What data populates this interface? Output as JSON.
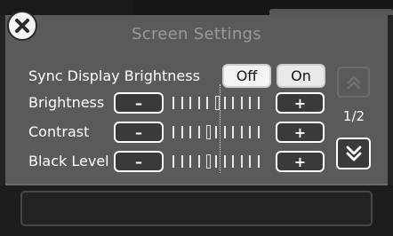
{
  "screen": {
    "title": "Screen Settings",
    "page_indicator": "1/2"
  },
  "close_icon": "close-icon",
  "settings": {
    "sync": {
      "label": "Sync Display Brightness",
      "off_label": "Off",
      "on_label": "On",
      "selected": "Off"
    },
    "brightness": {
      "label": "Brightness",
      "minus": "–",
      "plus": "+",
      "level_fraction": 0.5
    },
    "contrast": {
      "label": "Contrast",
      "minus": "–",
      "plus": "+",
      "level_fraction": 0.36
    },
    "black_level": {
      "label": "Black Level",
      "minus": "–",
      "plus": "+",
      "level_fraction": 0.36
    }
  },
  "scroll": {
    "up_icon": "chevron-up-double-icon",
    "down_icon": "chevron-down-double-icon"
  },
  "colors": {
    "panel": "#5a5a5a",
    "background": "#232323",
    "button_dark": "#3a3a3a",
    "button_light": "#e9e9e9",
    "title_text": "#9a9a9a"
  }
}
